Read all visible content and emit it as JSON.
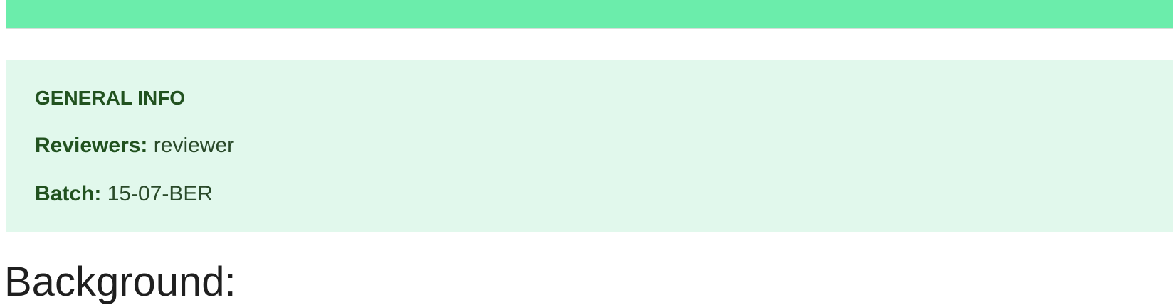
{
  "colors": {
    "top_bar": "#6bedab",
    "panel_background": "#e1f8ec",
    "panel_text": "#21521f",
    "heading_text": "#1f1f1f"
  },
  "general_info": {
    "heading": "GENERAL INFO",
    "reviewers_label": "Reviewers:",
    "reviewers_value": "reviewer",
    "batch_label": "Batch:",
    "batch_value": "15-07-BER"
  },
  "main": {
    "section_heading": "Background:"
  }
}
